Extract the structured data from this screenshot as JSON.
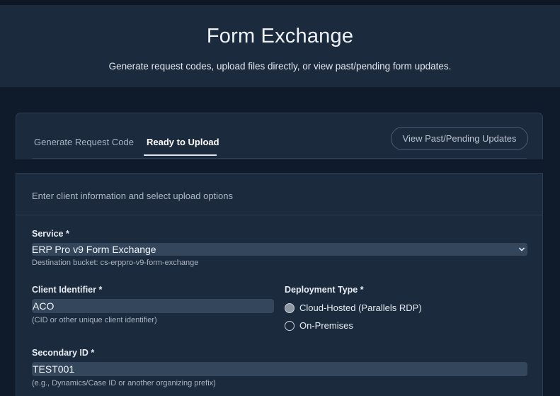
{
  "header": {
    "title": "Form Exchange",
    "subtitle": "Generate request codes, upload files directly, or view past/pending form updates."
  },
  "tabs": {
    "generate": "Generate Request Code",
    "ready": "Ready to Upload",
    "active": "Ready to Upload"
  },
  "view_updates_button": "View Past/Pending Updates",
  "form": {
    "instructions": "Enter client information and select upload options",
    "service": {
      "label": "Service *",
      "value": "ERP Pro v9 Form Exchange",
      "hint": "Destination bucket: cs-erppro-v9-form-exchange"
    },
    "client_id": {
      "label": "Client Identifier *",
      "value": "ACO",
      "hint": "(CID or other unique client identifier)"
    },
    "deployment": {
      "label": "Deployment Type *",
      "options": [
        "Cloud-Hosted (Parallels RDP)",
        "On-Premises"
      ],
      "selected": "Cloud-Hosted (Parallels RDP)"
    },
    "secondary_id": {
      "label": "Secondary ID *",
      "value": "TEST001",
      "hint": "(e.g., Dynamics/Case ID or another organizing prefix)"
    }
  },
  "icons": {
    "select_chevron": "chevron-down-icon"
  }
}
